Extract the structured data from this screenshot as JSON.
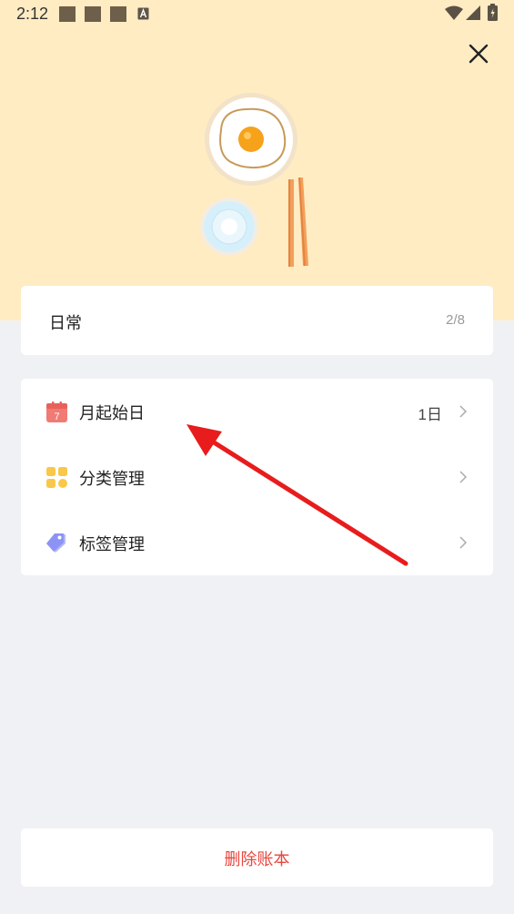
{
  "status_bar": {
    "time": "2:12"
  },
  "book": {
    "name": "日常",
    "count": "2/8"
  },
  "settings": {
    "items": [
      {
        "label": "月起始日",
        "value": "1日",
        "icon": "calendar-icon",
        "icon_color": "#f07b74"
      },
      {
        "label": "分类管理",
        "value": "",
        "icon": "category-grid-icon",
        "icon_color": "#f9c84a"
      },
      {
        "label": "标签管理",
        "value": "",
        "icon": "tag-icon",
        "icon_color": "#8c93f5"
      }
    ],
    "calendar_icon_day": "7"
  },
  "delete_button": {
    "label": "删除账本",
    "color": "#e8453c"
  },
  "colors": {
    "hero_bg": "#ffecc3",
    "page_bg": "#f0f1f5",
    "annotation_arrow": "#e81c1c"
  }
}
